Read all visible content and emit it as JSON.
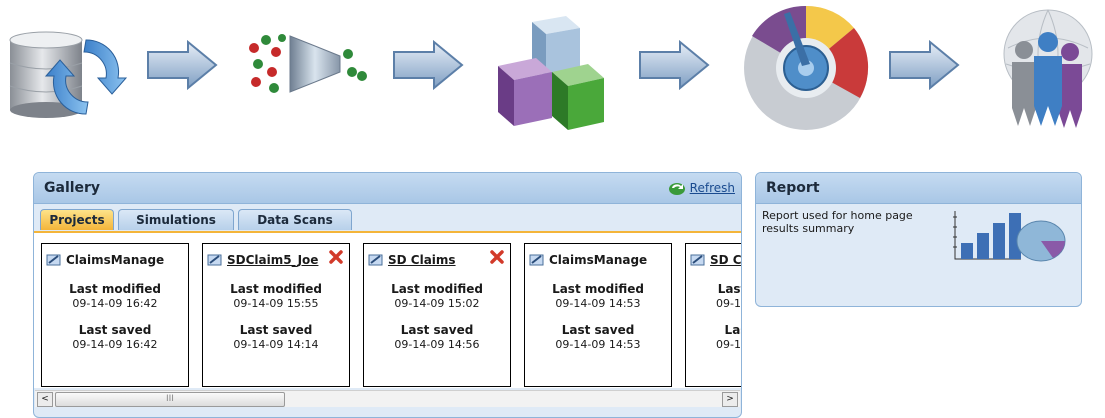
{
  "flow": {
    "steps": [
      {
        "icon": "database-sync-icon"
      },
      {
        "icon": "arrow-right-icon"
      },
      {
        "icon": "data-filter-funnel-icon"
      },
      {
        "icon": "arrow-right-icon"
      },
      {
        "icon": "data-cubes-icon"
      },
      {
        "icon": "arrow-right-icon"
      },
      {
        "icon": "dashboard-gauge-icon"
      },
      {
        "icon": "arrow-right-icon"
      },
      {
        "icon": "users-globe-icon"
      }
    ]
  },
  "gallery": {
    "title": "Gallery",
    "refresh_label": "Refresh",
    "tabs": [
      {
        "label": "Projects",
        "active": true
      },
      {
        "label": "Simulations",
        "active": false
      },
      {
        "label": "Data Scans",
        "active": false
      }
    ],
    "cards": [
      {
        "title": "ClaimsManage",
        "linked": false,
        "deletable": false,
        "modified_label": "Last modified",
        "modified": "09-14-09 16:42",
        "saved_label": "Last saved",
        "saved": "09-14-09 16:42"
      },
      {
        "title": "SDClaim5_Joe",
        "linked": true,
        "deletable": true,
        "modified_label": "Last modified",
        "modified": "09-14-09 15:55",
        "saved_label": "Last saved",
        "saved": "09-14-09 14:14"
      },
      {
        "title": "SD Claims",
        "linked": true,
        "deletable": true,
        "modified_label": "Last modified",
        "modified": "09-14-09 15:02",
        "saved_label": "Last saved",
        "saved": "09-14-09 14:56"
      },
      {
        "title": "ClaimsManage",
        "linked": false,
        "deletable": false,
        "modified_label": "Last modified",
        "modified": "09-14-09 14:53",
        "saved_label": "Last saved",
        "saved": "09-14-09 14:53"
      },
      {
        "title": "SD C",
        "linked": true,
        "deletable": false,
        "modified_label": "Last",
        "modified": "09-14",
        "saved_label": "Las",
        "saved": "09-14"
      }
    ],
    "scrollbar": {
      "left_arrow": "<",
      "right_arrow": ">",
      "grip": "III"
    }
  },
  "report": {
    "title": "Report",
    "description": "Report used for home page results summary",
    "chart_icon": "bar-pie-chart-icon"
  },
  "colors": {
    "panel_header": "#a9c7e6",
    "panel_body": "#dfeaf6",
    "active_tab": "#f4b53a",
    "delete_icon": "#d23a2a"
  }
}
